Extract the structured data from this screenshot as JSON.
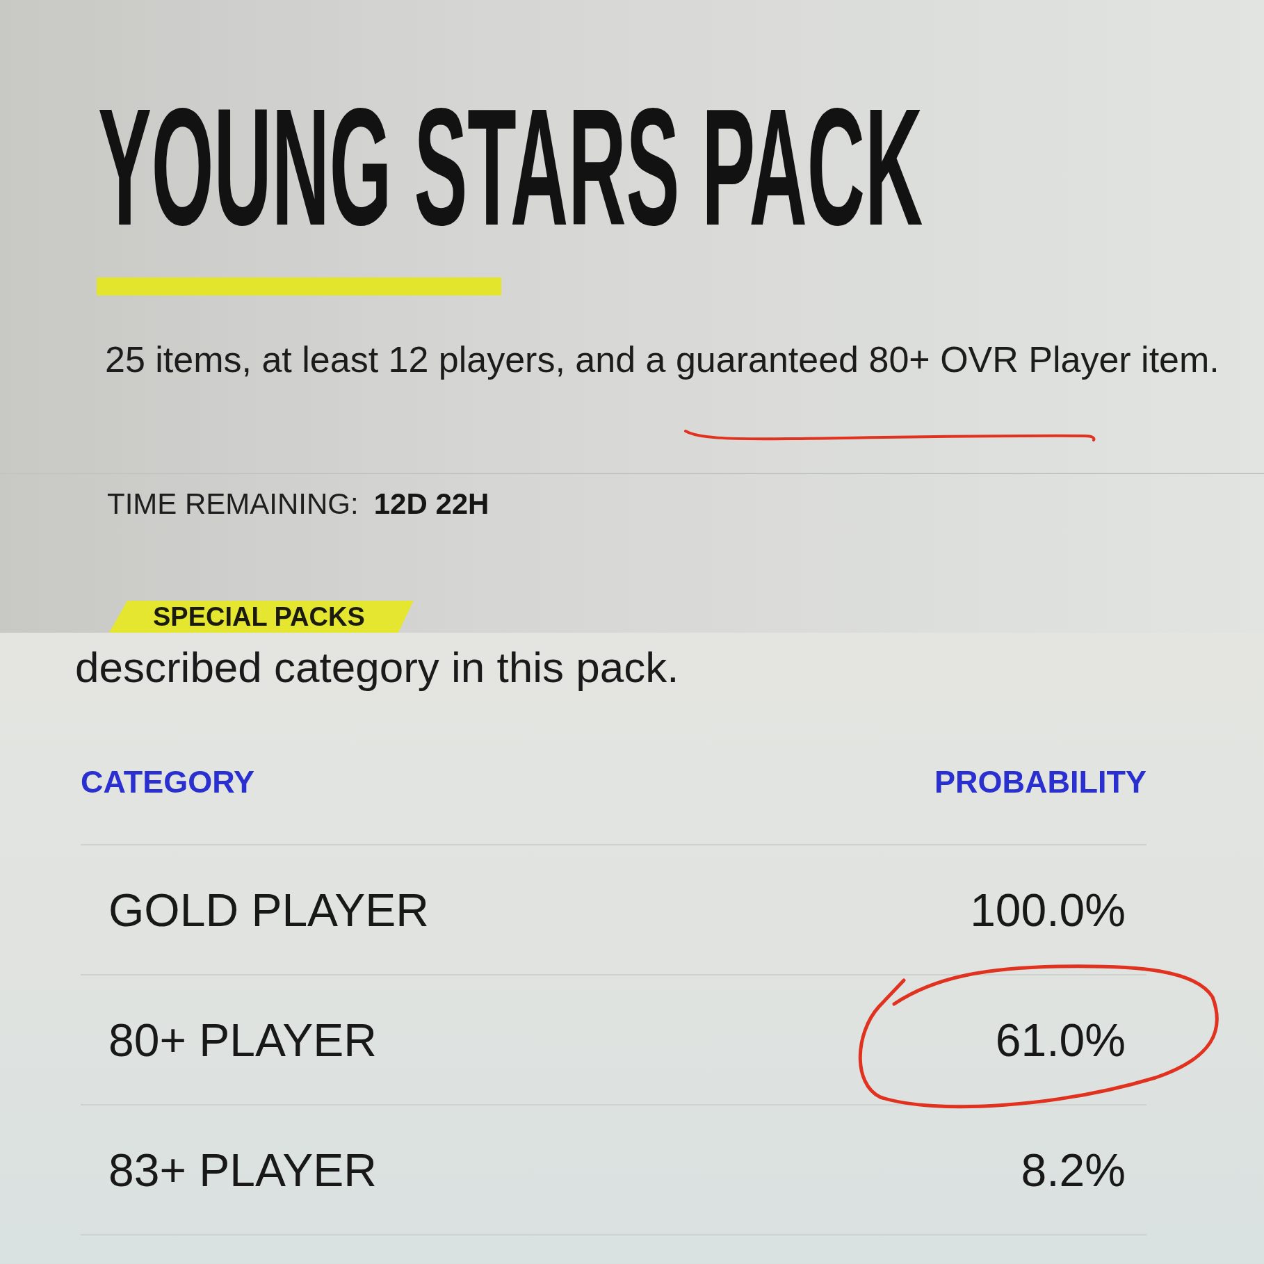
{
  "header": {
    "title": "YOUNG STARS PACK",
    "description": {
      "text": "25 items, at least 12 players, and a guaranteed 80+ OVR Player item.",
      "underlined": true
    },
    "time_remaining": {
      "label": "TIME REMAINING:",
      "value": "12D 22H"
    },
    "tag": "SPECIAL PACKS"
  },
  "odds": {
    "note": "described category in this pack.",
    "columns": [
      "CATEGORY",
      "PROBABILITY"
    ],
    "rows": [
      {
        "category": "GOLD PLAYER",
        "probability": "100.0%",
        "circled": false
      },
      {
        "category": "80+ PLAYER",
        "probability": "61.0%",
        "circled": true
      },
      {
        "category": "83+ PLAYER",
        "probability": "8.2%",
        "circled": false
      }
    ]
  }
}
